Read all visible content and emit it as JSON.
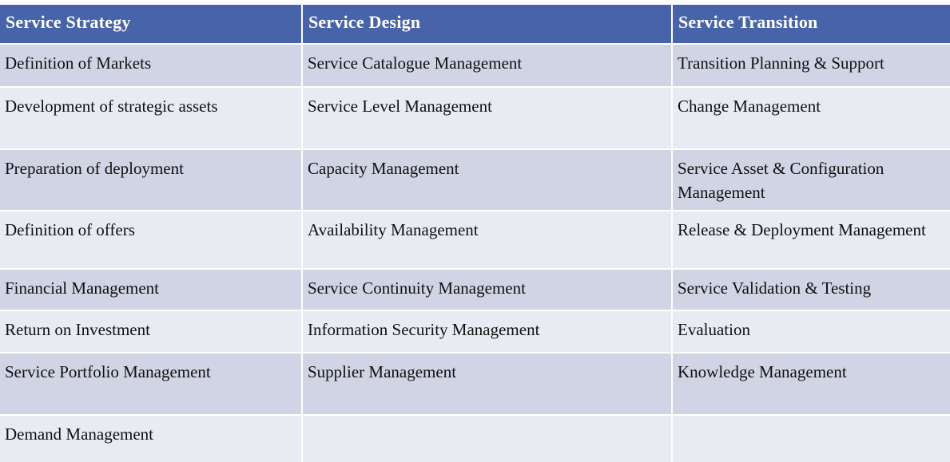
{
  "table": {
    "header_color": "#4763a9",
    "row_color_odd": "#d0d4e4",
    "row_color_even": "#e9ebf2",
    "columns": [
      "Service Strategy",
      "Service Design",
      "Service Transition"
    ],
    "rows": [
      [
        "Definition of Markets",
        "Service Catalogue Management",
        "Transition Planning & Support"
      ],
      [
        "Development of strategic assets",
        "Service Level Management",
        "Change Management"
      ],
      [
        "Preparation of deployment",
        "Capacity Management",
        "Service Asset & Configuration Management"
      ],
      [
        "Definition of offers",
        "Availability Management",
        "Release & Deployment Management"
      ],
      [
        "Financial Management",
        "Service Continuity Management",
        "Service Validation & Testing"
      ],
      [
        "Return on Investment",
        "Information Security Management",
        "Evaluation"
      ],
      [
        "Service Portfolio Management",
        "Supplier Management",
        "Knowledge Management"
      ],
      [
        "Demand Management",
        "",
        ""
      ]
    ]
  }
}
